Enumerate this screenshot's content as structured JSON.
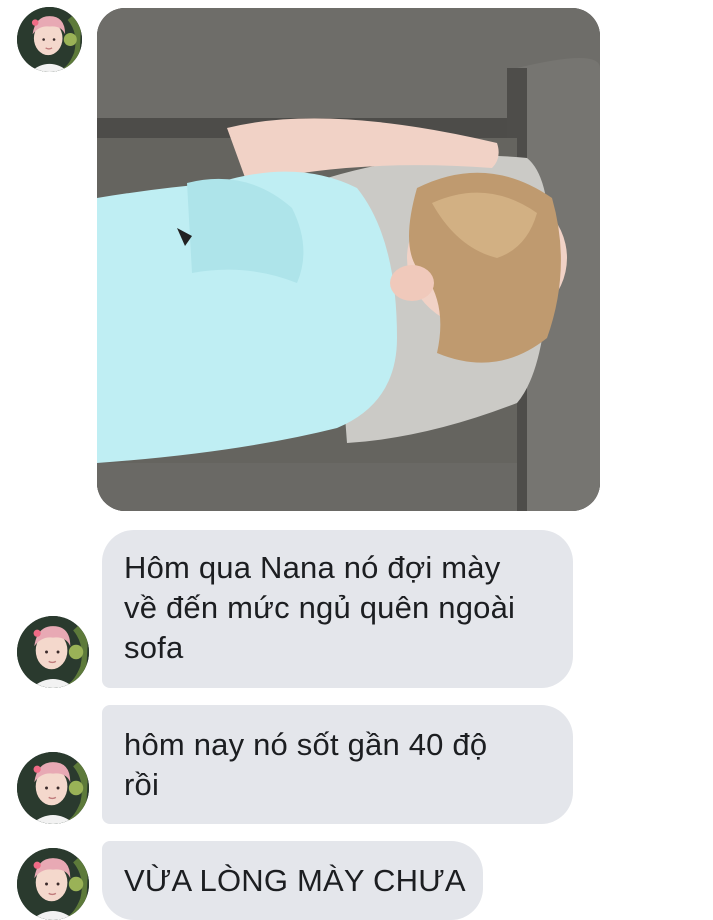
{
  "conversation": {
    "photo_message": {
      "icon": "photo-image-of-sleeping-person"
    },
    "messages": [
      {
        "lines": [
          "Hôm qua Nana nó đợi mày",
          "về đến mức ngủ quên ngoài",
          "sofa"
        ]
      },
      {
        "lines": [
          "hôm nay nó sốt gần 40 độ",
          "rồi"
        ]
      },
      {
        "lines": [
          "VỪA LÒNG MÀY CHƯA"
        ]
      }
    ]
  },
  "colors": {
    "bubble_background": "#e4e6eb",
    "bubble_text": "#1c1e21",
    "page_background": "#ffffff",
    "avatar_hair": "#e7a9b3",
    "shirt": "#bfeef3",
    "sofa": "#5e5d5a"
  }
}
